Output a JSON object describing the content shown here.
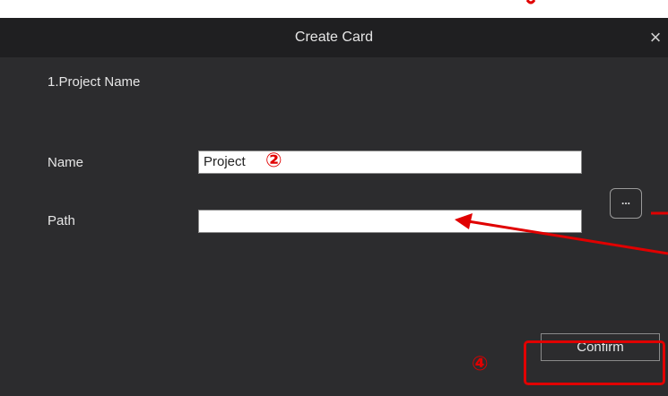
{
  "dialog": {
    "title": "Create Card",
    "close_icon": "×",
    "section_heading": "1.Project Name",
    "name_label": "Name",
    "name_value": "Project",
    "path_label": "Path",
    "path_value": "",
    "browse_label": "...",
    "confirm_label": "Confirm"
  },
  "annotations": {
    "step2": "②",
    "step4": "④",
    "color": "#e00000"
  }
}
